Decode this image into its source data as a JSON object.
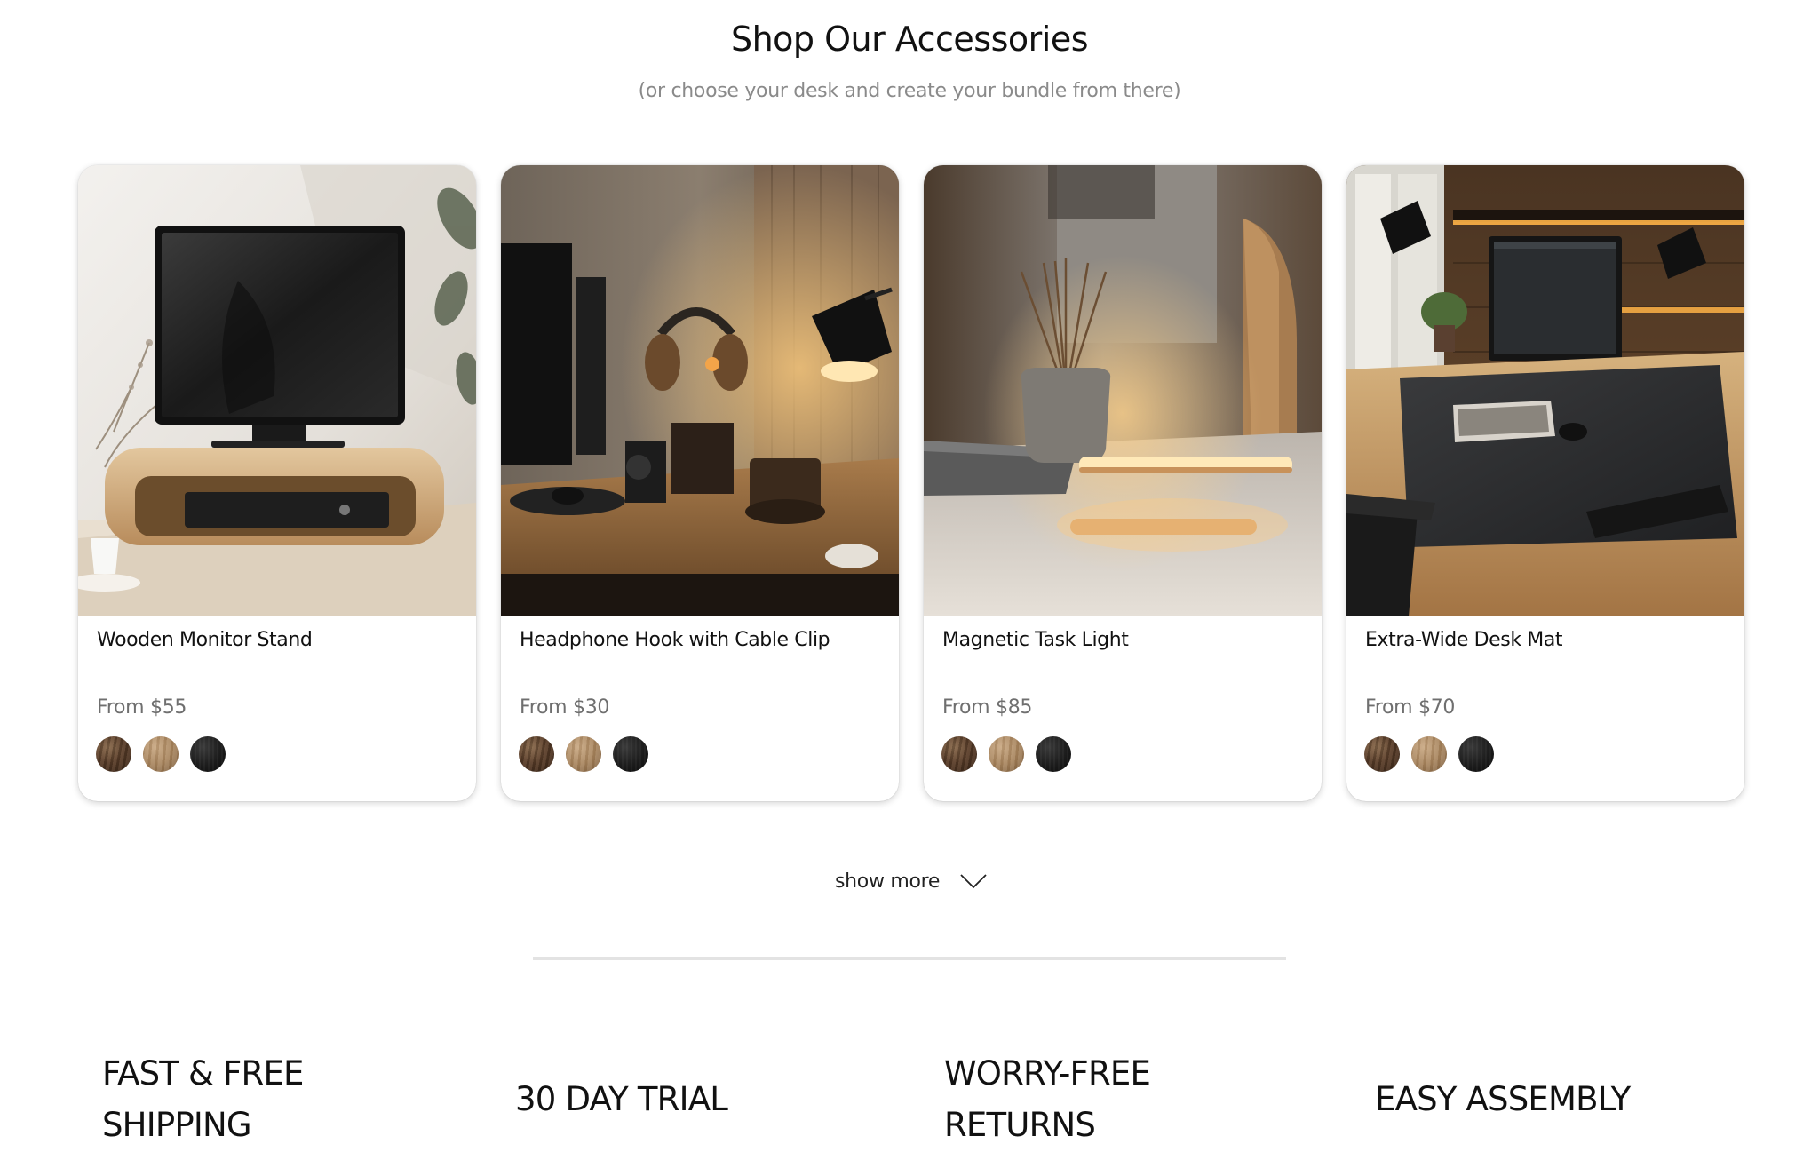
{
  "section": {
    "title": "Shop Our Accessories",
    "subtitle": "(or choose your desk and create your bundle from there)"
  },
  "products": [
    {
      "name": "Wooden Monitor Stand",
      "price": "From $55",
      "image_icon": "monitor-stand-photo"
    },
    {
      "name": "Headphone Hook with Cable Clip",
      "price": "From $30",
      "image_icon": "headphone-hook-photo"
    },
    {
      "name": "Magnetic Task Light",
      "price": "From $85",
      "image_icon": "task-light-photo"
    },
    {
      "name": "Extra-Wide Desk Mat",
      "price": "From $70",
      "image_icon": "desk-mat-photo"
    }
  ],
  "swatch_colors": {
    "dark_walnut": "#5c3f2a",
    "light_oak": "#a9865f",
    "black": "#1c1c1c"
  },
  "show_more": {
    "label": "show more",
    "icon": "chevron-down-icon"
  },
  "features": [
    {
      "line1": "FAST & FREE",
      "line2": "SHIPPING"
    },
    {
      "line1": "30 DAY TRIAL"
    },
    {
      "line1": "WORRY-FREE",
      "line2": "RETURNS"
    },
    {
      "line1": "EASY ASSEMBLY"
    }
  ]
}
